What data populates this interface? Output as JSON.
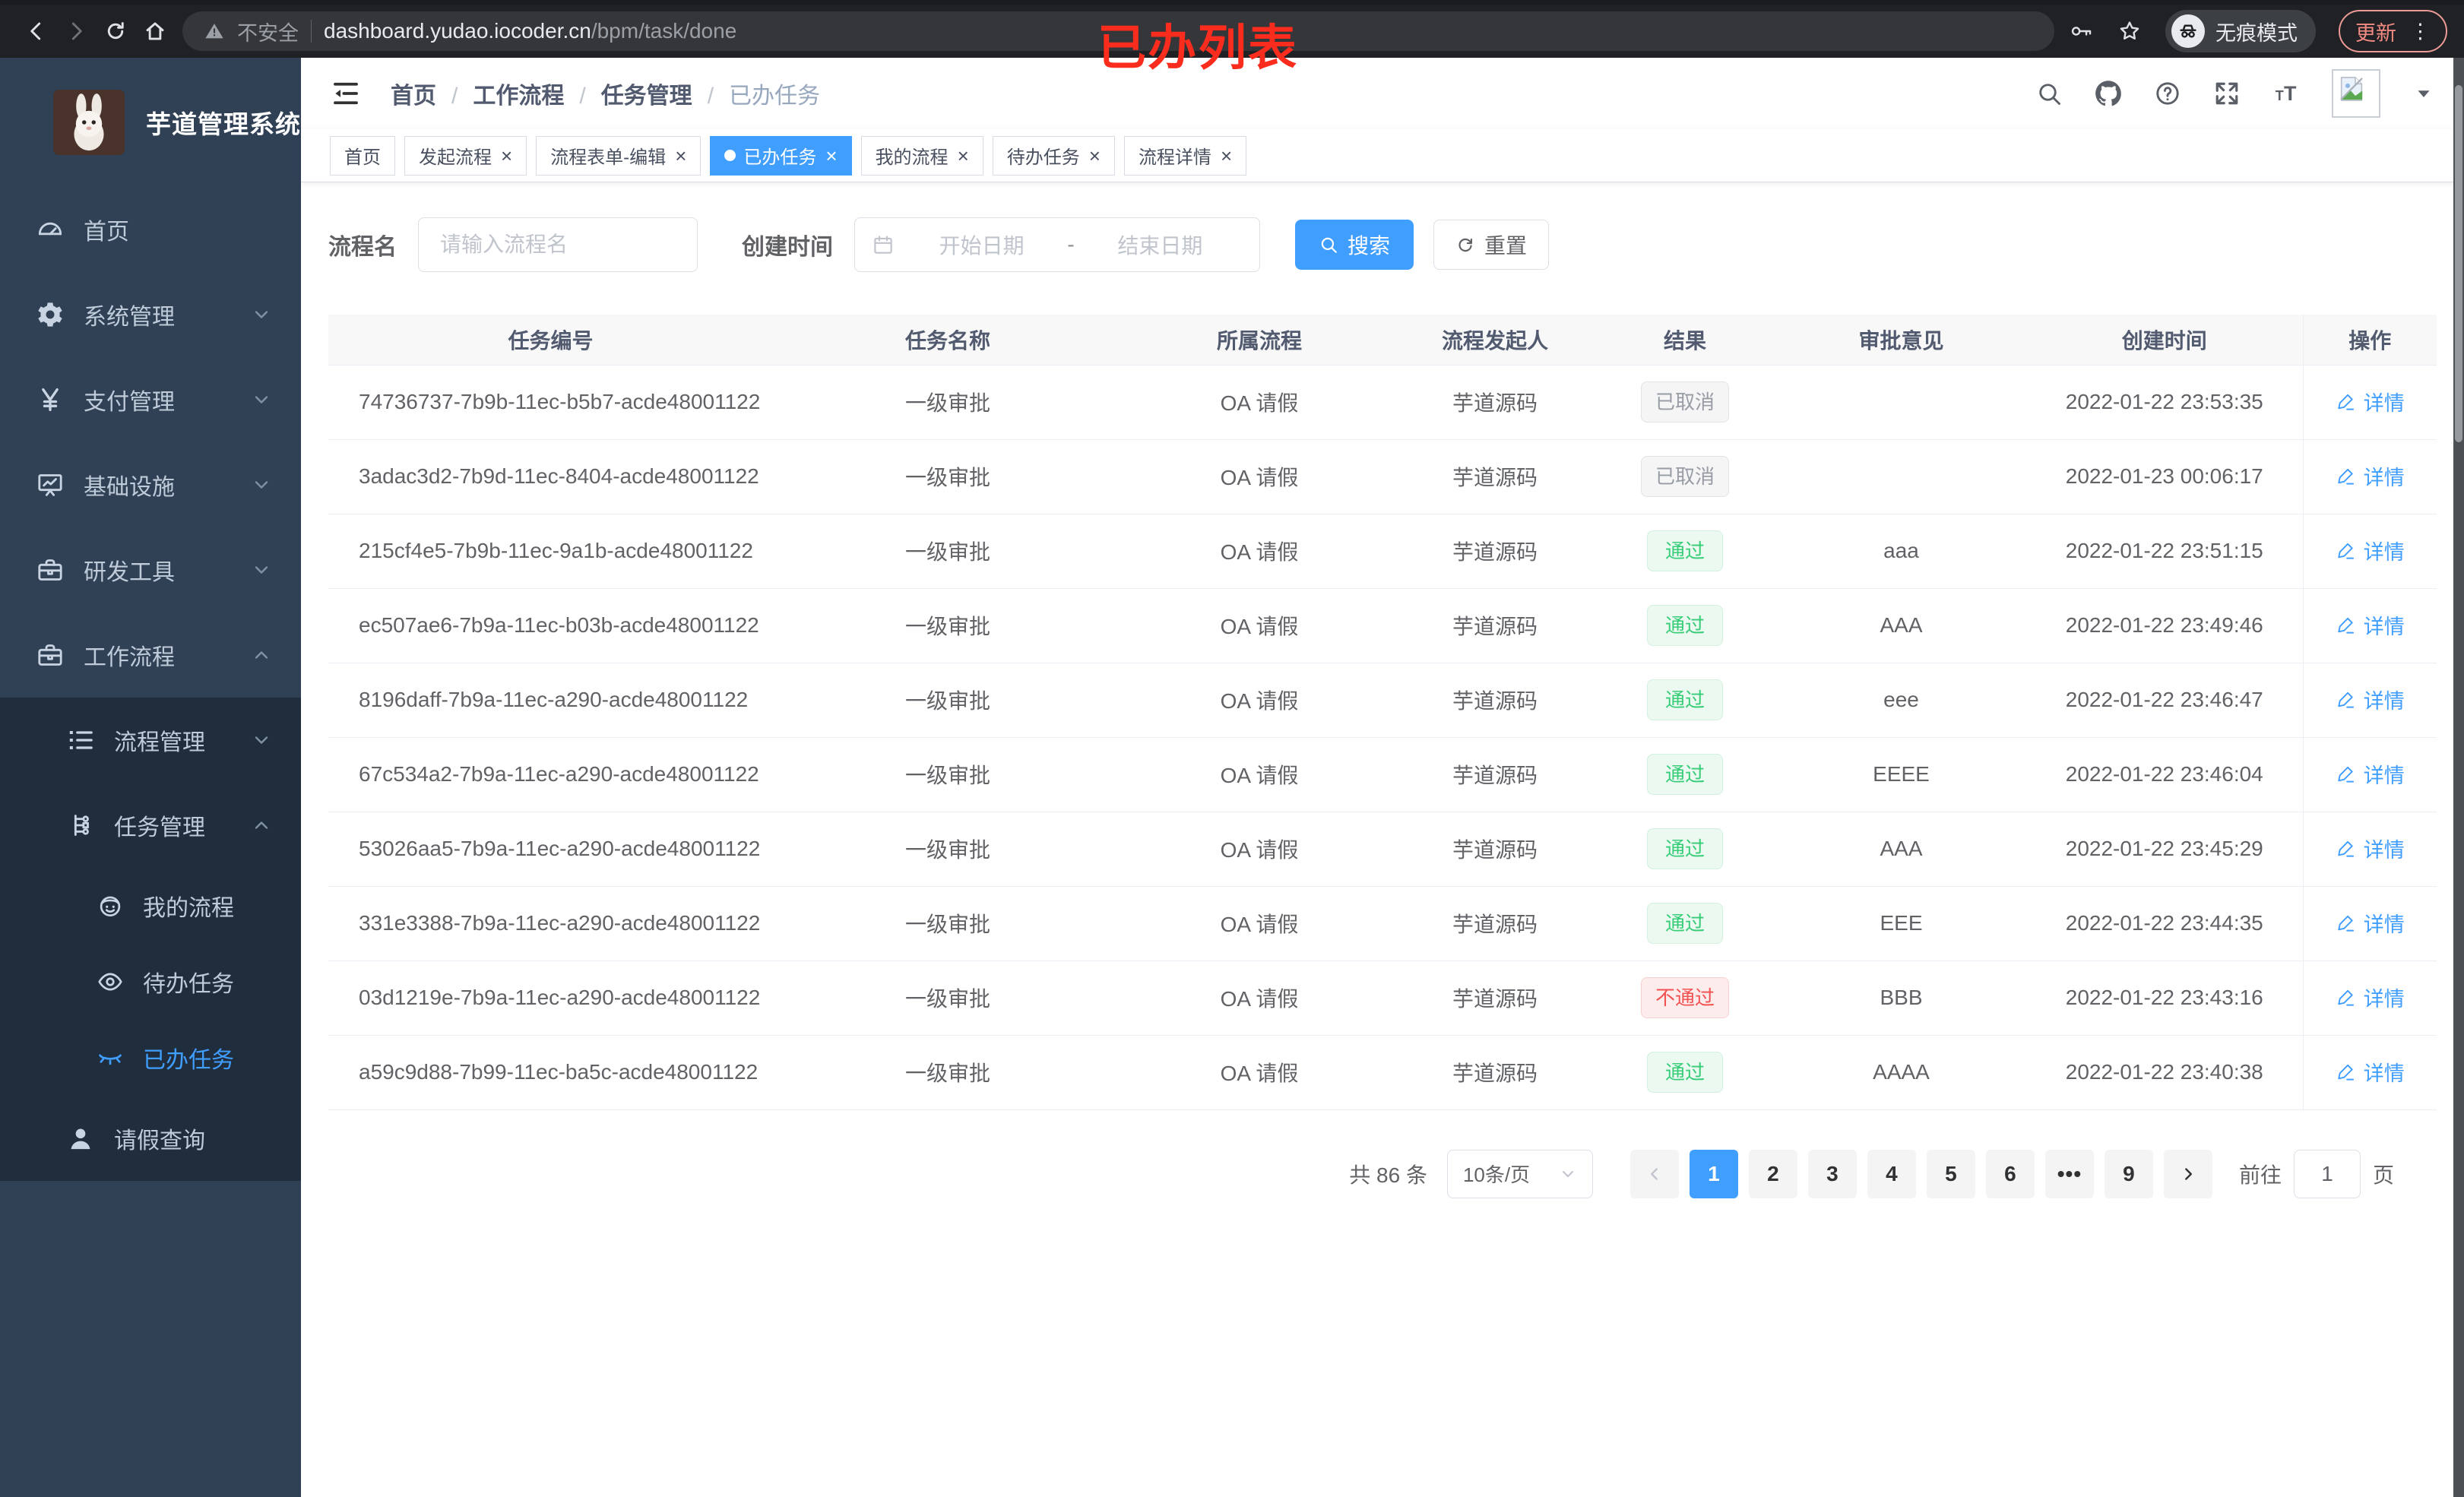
{
  "browser": {
    "not_secure": "不安全",
    "url_host": "dashboard.yudao.iocoder.cn",
    "url_path": "/bpm/task/done",
    "incognito_label": "无痕模式",
    "update_label": "更新",
    "annotation": "已办列表"
  },
  "sidebar": {
    "title": "芋道管理系统",
    "items": [
      {
        "icon": "dashboard-icon",
        "label": "首页",
        "level": 1
      },
      {
        "icon": "gear-icon",
        "label": "系统管理",
        "level": 1,
        "chevron": "down"
      },
      {
        "icon": "yen-icon",
        "label": "支付管理",
        "level": 1,
        "chevron": "down"
      },
      {
        "icon": "infra-icon",
        "label": "基础设施",
        "level": 1,
        "chevron": "down"
      },
      {
        "icon": "briefcase-icon",
        "label": "研发工具",
        "level": 1,
        "chevron": "down"
      },
      {
        "icon": "briefcase-icon",
        "label": "工作流程",
        "level": 1,
        "chevron": "up"
      },
      {
        "icon": "list-tree-icon",
        "label": "流程管理",
        "level": 2,
        "chevron": "down",
        "area": "sub"
      },
      {
        "icon": "org-tree-icon",
        "label": "任务管理",
        "level": 2,
        "chevron": "up",
        "area": "sub"
      },
      {
        "icon": "face-icon",
        "label": "我的流程",
        "level": 3,
        "area": "sub"
      },
      {
        "icon": "eye-icon",
        "label": "待办任务",
        "level": 3,
        "area": "sub"
      },
      {
        "icon": "eye-closed-icon",
        "label": "已办任务",
        "level": 3,
        "area": "sub",
        "state": "active"
      },
      {
        "icon": "user-icon",
        "label": "请假查询",
        "level": 2,
        "area": "sub"
      }
    ]
  },
  "breadcrumb": {
    "items": [
      {
        "label": "首页"
      },
      {
        "label": "工作流程"
      },
      {
        "label": "任务管理"
      },
      {
        "label": "已办任务",
        "state": "current"
      }
    ]
  },
  "tabs": [
    {
      "label": "首页",
      "closable": false
    },
    {
      "label": "发起流程",
      "closable": true
    },
    {
      "label": "流程表单-编辑",
      "closable": true
    },
    {
      "label": "已办任务",
      "closable": true,
      "state": "active"
    },
    {
      "label": "我的流程",
      "closable": true
    },
    {
      "label": "待办任务",
      "closable": true
    },
    {
      "label": "流程详情",
      "closable": true
    }
  ],
  "filters": {
    "name_label": "流程名",
    "name_placeholder": "请输入流程名",
    "time_label": "创建时间",
    "start_placeholder": "开始日期",
    "range_separator": "-",
    "end_placeholder": "结束日期",
    "search_label": "搜索",
    "reset_label": "重置"
  },
  "table": {
    "columns": [
      "任务编号",
      "任务名称",
      "所属流程",
      "流程发起人",
      "结果",
      "审批意见",
      "创建时间",
      "操作"
    ],
    "action_label": "详情",
    "rows": [
      {
        "id": "74736737-7b9b-11ec-b5b7-acde48001122",
        "name": "一级审批",
        "process": "OA 请假",
        "starter": "芋道源码",
        "result": "已取消",
        "result_type": "info",
        "comment": "",
        "created": "2022-01-22 23:53:35"
      },
      {
        "id": "3adac3d2-7b9d-11ec-8404-acde48001122",
        "name": "一级审批",
        "process": "OA 请假",
        "starter": "芋道源码",
        "result": "已取消",
        "result_type": "info",
        "comment": "",
        "created": "2022-01-23 00:06:17"
      },
      {
        "id": "215cf4e5-7b9b-11ec-9a1b-acde48001122",
        "name": "一级审批",
        "process": "OA 请假",
        "starter": "芋道源码",
        "result": "通过",
        "result_type": "success",
        "comment": "aaa",
        "created": "2022-01-22 23:51:15"
      },
      {
        "id": "ec507ae6-7b9a-11ec-b03b-acde48001122",
        "name": "一级审批",
        "process": "OA 请假",
        "starter": "芋道源码",
        "result": "通过",
        "result_type": "success",
        "comment": "AAA",
        "created": "2022-01-22 23:49:46"
      },
      {
        "id": "8196daff-7b9a-11ec-a290-acde48001122",
        "name": "一级审批",
        "process": "OA 请假",
        "starter": "芋道源码",
        "result": "通过",
        "result_type": "success",
        "comment": "eee",
        "created": "2022-01-22 23:46:47"
      },
      {
        "id": "67c534a2-7b9a-11ec-a290-acde48001122",
        "name": "一级审批",
        "process": "OA 请假",
        "starter": "芋道源码",
        "result": "通过",
        "result_type": "success",
        "comment": "EEEE",
        "created": "2022-01-22 23:46:04"
      },
      {
        "id": "53026aa5-7b9a-11ec-a290-acde48001122",
        "name": "一级审批",
        "process": "OA 请假",
        "starter": "芋道源码",
        "result": "通过",
        "result_type": "success",
        "comment": "AAA",
        "created": "2022-01-22 23:45:29"
      },
      {
        "id": "331e3388-7b9a-11ec-a290-acde48001122",
        "name": "一级审批",
        "process": "OA 请假",
        "starter": "芋道源码",
        "result": "通过",
        "result_type": "success",
        "comment": "EEE",
        "created": "2022-01-22 23:44:35"
      },
      {
        "id": "03d1219e-7b9a-11ec-a290-acde48001122",
        "name": "一级审批",
        "process": "OA 请假",
        "starter": "芋道源码",
        "result": "不通过",
        "result_type": "danger",
        "comment": "BBB",
        "created": "2022-01-22 23:43:16"
      },
      {
        "id": "a59c9d88-7b99-11ec-ba5c-acde48001122",
        "name": "一级审批",
        "process": "OA 请假",
        "starter": "芋道源码",
        "result": "通过",
        "result_type": "success",
        "comment": "AAAA",
        "created": "2022-01-22 23:40:38"
      }
    ]
  },
  "pagination": {
    "total_label": "共 86 条",
    "page_size": "10条/页",
    "pages": [
      {
        "label": "1",
        "type": "active"
      },
      {
        "label": "2",
        "type": "normal"
      },
      {
        "label": "3",
        "type": "normal"
      },
      {
        "label": "4",
        "type": "normal"
      },
      {
        "label": "5",
        "type": "normal"
      },
      {
        "label": "6",
        "type": "normal"
      },
      {
        "label": "•••",
        "type": "ellipsis"
      },
      {
        "label": "9",
        "type": "normal"
      }
    ],
    "goto_label": "前往",
    "goto_value": "1",
    "goto_suffix": "页"
  },
  "colors": {
    "accent": "#409eff",
    "success": "#37cd78",
    "danger": "#f35252",
    "info": "#989ca5",
    "sidebar_bg": "#304156",
    "submenu_bg": "#1f2d3d",
    "annotation_red": "#f92c1d"
  }
}
